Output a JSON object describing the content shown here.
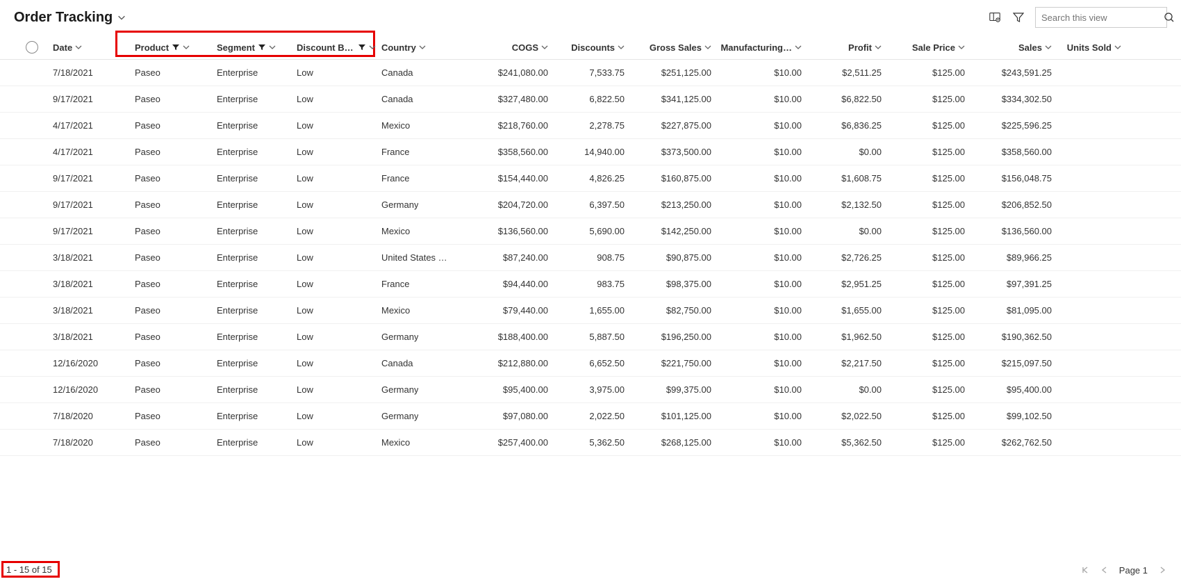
{
  "header": {
    "title": "Order Tracking",
    "search_placeholder": "Search this view"
  },
  "columns": {
    "date": "Date",
    "product": "Product",
    "segment": "Segment",
    "discount_band": "Discount Ba…",
    "country": "Country",
    "cogs": "COGS",
    "discounts": "Discounts",
    "gross_sales": "Gross Sales",
    "manufacturing": "Manufacturing…",
    "profit": "Profit",
    "sale_price": "Sale Price",
    "sales": "Sales",
    "units_sold": "Units Sold"
  },
  "rows": [
    {
      "date": "7/18/2021",
      "product": "Paseo",
      "segment": "Enterprise",
      "disc": "Low",
      "country": "Canada",
      "cogs": "$241,080.00",
      "discounts": "7,533.75",
      "gross": "$251,125.00",
      "manuf": "$10.00",
      "profit": "$2,511.25",
      "saleprice": "$125.00",
      "sales": "$243,591.25"
    },
    {
      "date": "9/17/2021",
      "product": "Paseo",
      "segment": "Enterprise",
      "disc": "Low",
      "country": "Canada",
      "cogs": "$327,480.00",
      "discounts": "6,822.50",
      "gross": "$341,125.00",
      "manuf": "$10.00",
      "profit": "$6,822.50",
      "saleprice": "$125.00",
      "sales": "$334,302.50"
    },
    {
      "date": "4/17/2021",
      "product": "Paseo",
      "segment": "Enterprise",
      "disc": "Low",
      "country": "Mexico",
      "cogs": "$218,760.00",
      "discounts": "2,278.75",
      "gross": "$227,875.00",
      "manuf": "$10.00",
      "profit": "$6,836.25",
      "saleprice": "$125.00",
      "sales": "$225,596.25"
    },
    {
      "date": "4/17/2021",
      "product": "Paseo",
      "segment": "Enterprise",
      "disc": "Low",
      "country": "France",
      "cogs": "$358,560.00",
      "discounts": "14,940.00",
      "gross": "$373,500.00",
      "manuf": "$10.00",
      "profit": "$0.00",
      "saleprice": "$125.00",
      "sales": "$358,560.00"
    },
    {
      "date": "9/17/2021",
      "product": "Paseo",
      "segment": "Enterprise",
      "disc": "Low",
      "country": "France",
      "cogs": "$154,440.00",
      "discounts": "4,826.25",
      "gross": "$160,875.00",
      "manuf": "$10.00",
      "profit": "$1,608.75",
      "saleprice": "$125.00",
      "sales": "$156,048.75"
    },
    {
      "date": "9/17/2021",
      "product": "Paseo",
      "segment": "Enterprise",
      "disc": "Low",
      "country": "Germany",
      "cogs": "$204,720.00",
      "discounts": "6,397.50",
      "gross": "$213,250.00",
      "manuf": "$10.00",
      "profit": "$2,132.50",
      "saleprice": "$125.00",
      "sales": "$206,852.50"
    },
    {
      "date": "9/17/2021",
      "product": "Paseo",
      "segment": "Enterprise",
      "disc": "Low",
      "country": "Mexico",
      "cogs": "$136,560.00",
      "discounts": "5,690.00",
      "gross": "$142,250.00",
      "manuf": "$10.00",
      "profit": "$0.00",
      "saleprice": "$125.00",
      "sales": "$136,560.00"
    },
    {
      "date": "3/18/2021",
      "product": "Paseo",
      "segment": "Enterprise",
      "disc": "Low",
      "country": "United States …",
      "cogs": "$87,240.00",
      "discounts": "908.75",
      "gross": "$90,875.00",
      "manuf": "$10.00",
      "profit": "$2,726.25",
      "saleprice": "$125.00",
      "sales": "$89,966.25"
    },
    {
      "date": "3/18/2021",
      "product": "Paseo",
      "segment": "Enterprise",
      "disc": "Low",
      "country": "France",
      "cogs": "$94,440.00",
      "discounts": "983.75",
      "gross": "$98,375.00",
      "manuf": "$10.00",
      "profit": "$2,951.25",
      "saleprice": "$125.00",
      "sales": "$97,391.25"
    },
    {
      "date": "3/18/2021",
      "product": "Paseo",
      "segment": "Enterprise",
      "disc": "Low",
      "country": "Mexico",
      "cogs": "$79,440.00",
      "discounts": "1,655.00",
      "gross": "$82,750.00",
      "manuf": "$10.00",
      "profit": "$1,655.00",
      "saleprice": "$125.00",
      "sales": "$81,095.00"
    },
    {
      "date": "3/18/2021",
      "product": "Paseo",
      "segment": "Enterprise",
      "disc": "Low",
      "country": "Germany",
      "cogs": "$188,400.00",
      "discounts": "5,887.50",
      "gross": "$196,250.00",
      "manuf": "$10.00",
      "profit": "$1,962.50",
      "saleprice": "$125.00",
      "sales": "$190,362.50"
    },
    {
      "date": "12/16/2020",
      "product": "Paseo",
      "segment": "Enterprise",
      "disc": "Low",
      "country": "Canada",
      "cogs": "$212,880.00",
      "discounts": "6,652.50",
      "gross": "$221,750.00",
      "manuf": "$10.00",
      "profit": "$2,217.50",
      "saleprice": "$125.00",
      "sales": "$215,097.50"
    },
    {
      "date": "12/16/2020",
      "product": "Paseo",
      "segment": "Enterprise",
      "disc": "Low",
      "country": "Germany",
      "cogs": "$95,400.00",
      "discounts": "3,975.00",
      "gross": "$99,375.00",
      "manuf": "$10.00",
      "profit": "$0.00",
      "saleprice": "$125.00",
      "sales": "$95,400.00"
    },
    {
      "date": "7/18/2020",
      "product": "Paseo",
      "segment": "Enterprise",
      "disc": "Low",
      "country": "Germany",
      "cogs": "$97,080.00",
      "discounts": "2,022.50",
      "gross": "$101,125.00",
      "manuf": "$10.00",
      "profit": "$2,022.50",
      "saleprice": "$125.00",
      "sales": "$99,102.50"
    },
    {
      "date": "7/18/2020",
      "product": "Paseo",
      "segment": "Enterprise",
      "disc": "Low",
      "country": "Mexico",
      "cogs": "$257,400.00",
      "discounts": "5,362.50",
      "gross": "$268,125.00",
      "manuf": "$10.00",
      "profit": "$5,362.50",
      "saleprice": "$125.00",
      "sales": "$262,762.50"
    }
  ],
  "footer": {
    "range": "1 - 15 of 15",
    "page_label": "Page 1"
  }
}
